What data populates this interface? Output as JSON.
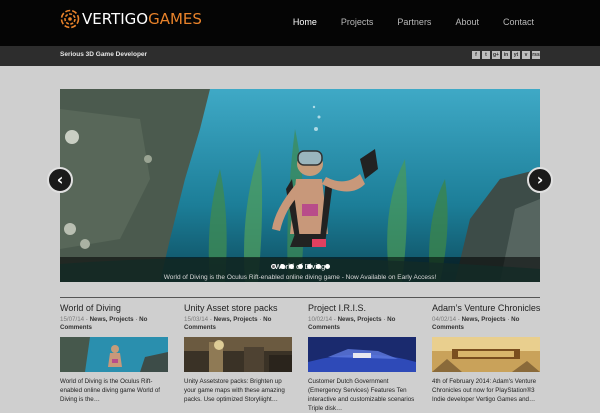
{
  "header": {
    "logo_part1": "VERTIGO",
    "logo_part2": "GAMES",
    "nav": [
      {
        "label": "Home",
        "active": true
      },
      {
        "label": "Projects",
        "active": false
      },
      {
        "label": "Partners",
        "active": false
      },
      {
        "label": "About",
        "active": false
      },
      {
        "label": "Contact",
        "active": false
      }
    ]
  },
  "subbar": {
    "tagline": "Serious 3D Game Developer",
    "social": [
      "f",
      "t",
      "g+",
      "in",
      "yt",
      "v",
      "rss"
    ]
  },
  "slider": {
    "caption_title": "World of Diving",
    "caption_text": "World of Diving is the Oculus Rift-enabled online diving game - Now Available on Early Access!",
    "dot_count": 7,
    "active_dot": 0,
    "prev_label": "‹",
    "next_label": "›"
  },
  "posts": [
    {
      "title": "World of Diving",
      "date": "15/07/14",
      "cats": "News, Projects",
      "comments": "No Comments",
      "excerpt": "World of Diving is the Oculus Rift-enabled online diving game World of Diving is the…"
    },
    {
      "title": "Unity Asset store packs",
      "date": "15/03/14",
      "cats": "News, Projects",
      "comments": "No Comments",
      "excerpt": "Unity Assetstore packs: Brighten up your game maps with these amazing packs. Use optimized Storyliight…"
    },
    {
      "title": "Project I.R.I.S.",
      "date": "10/02/14",
      "cats": "News, Projects",
      "comments": "No Comments",
      "excerpt": "Customer Dutch Government (Emergency Services) Features Ten interactive and customizable scenarios Triple disk…"
    },
    {
      "title": "Adam’s Venture Chronicles",
      "date": "04/02/14",
      "cats": "News, Projects",
      "comments": "No Comments",
      "excerpt": "4th of February 2014: Adam's Venture Chronicles out now for PlayStation®3 Indie developer Vertigo Games and…"
    }
  ],
  "colors": {
    "accent": "#e8822a",
    "header_bg": "#050505",
    "subbar_bg": "#2d2d2d",
    "page_bg": "#cfcfcf"
  }
}
